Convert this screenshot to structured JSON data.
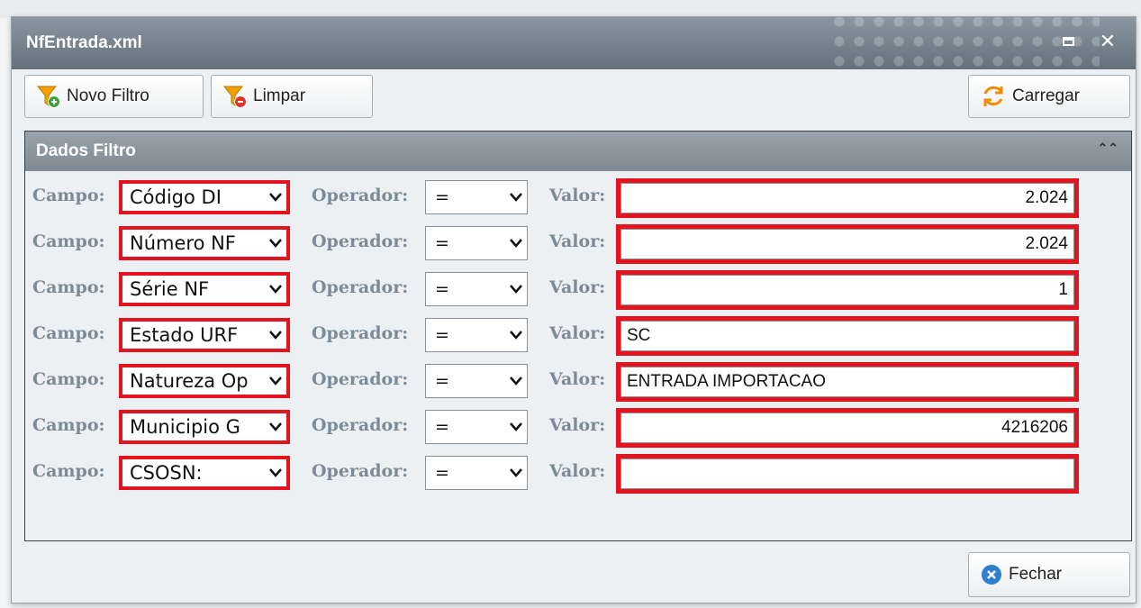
{
  "window": {
    "title": "NfEntrada.xml"
  },
  "toolbar": {
    "novo_filtro": "Novo Filtro",
    "limpar": "Limpar",
    "carregar": "Carregar"
  },
  "panel": {
    "title": "Dados Filtro"
  },
  "labels": {
    "campo": "Campo:",
    "operador": "Operador:",
    "valor": "Valor:"
  },
  "filters": [
    {
      "campo": "Código DI",
      "operador": "=",
      "valor": "2.024"
    },
    {
      "campo": "Número NF",
      "operador": "=",
      "valor": "2.024"
    },
    {
      "campo": "Série NF",
      "operador": "=",
      "valor": "1"
    },
    {
      "campo": "Estado URF",
      "operador": "=",
      "valor": "SC"
    },
    {
      "campo": "Natureza Op",
      "operador": "=",
      "valor": "ENTRADA IMPORTACAO"
    },
    {
      "campo": "Municipio G",
      "operador": "=",
      "valor": "4216206"
    },
    {
      "campo": "CSOSN:",
      "operador": "=",
      "valor": ""
    }
  ],
  "footer": {
    "fechar": "Fechar"
  },
  "colors": {
    "highlight": "#e3141f",
    "title_bar": "#6f7c88",
    "label": "#7c8b99"
  }
}
